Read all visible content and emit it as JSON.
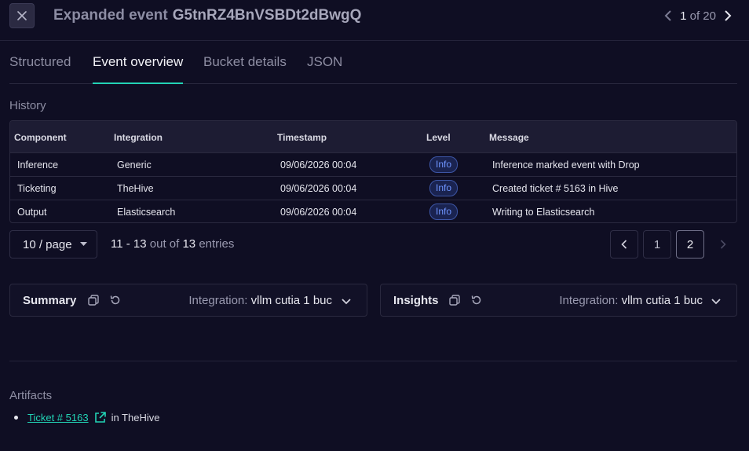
{
  "header": {
    "title": "Expanded event",
    "event_id": "G5tnRZ4BnVSBDt2dBwgQ",
    "pager_current": "1",
    "pager_of": "of 20"
  },
  "tabs": [
    "Structured",
    "Event overview",
    "Bucket details",
    "JSON"
  ],
  "active_tab": "Event overview",
  "history": {
    "label": "History",
    "columns": [
      "Component",
      "Integration",
      "Timestamp",
      "Level",
      "Message"
    ],
    "rows": [
      {
        "component": "Inference",
        "integration": "Generic",
        "timestamp": "09/06/2026 00:04",
        "level": "Info",
        "message": "Inference marked event with Drop"
      },
      {
        "component": "Ticketing",
        "integration": "TheHive",
        "timestamp": "09/06/2026 00:04",
        "level": "Info",
        "message": "Created ticket # 5163 in Hive"
      },
      {
        "component": "Output",
        "integration": "Elasticsearch",
        "timestamp": "09/06/2026 00:04",
        "level": "Info",
        "message": "Writing to Elasticsearch"
      }
    ],
    "per_page": "10 / page",
    "range": "11 - 13",
    "out_of": "out of",
    "total": "13",
    "entries_word": "entries",
    "pages": [
      "1",
      "2"
    ],
    "current_page": "2"
  },
  "panels": {
    "summary": {
      "title": "Summary",
      "integration_label": "Integration:",
      "integration_value": "vllm cutia 1 buc"
    },
    "insights": {
      "title": "Insights",
      "integration_label": "Integration:",
      "integration_value": "vllm cutia 1 buc"
    }
  },
  "artifacts": {
    "label": "Artifacts",
    "items": [
      {
        "link_text": "Ticket # 5163",
        "suffix": "in TheHive"
      }
    ]
  },
  "colors": {
    "accent": "#22d3b5",
    "badge": "#6f95ff",
    "background": "#0f0e23"
  }
}
